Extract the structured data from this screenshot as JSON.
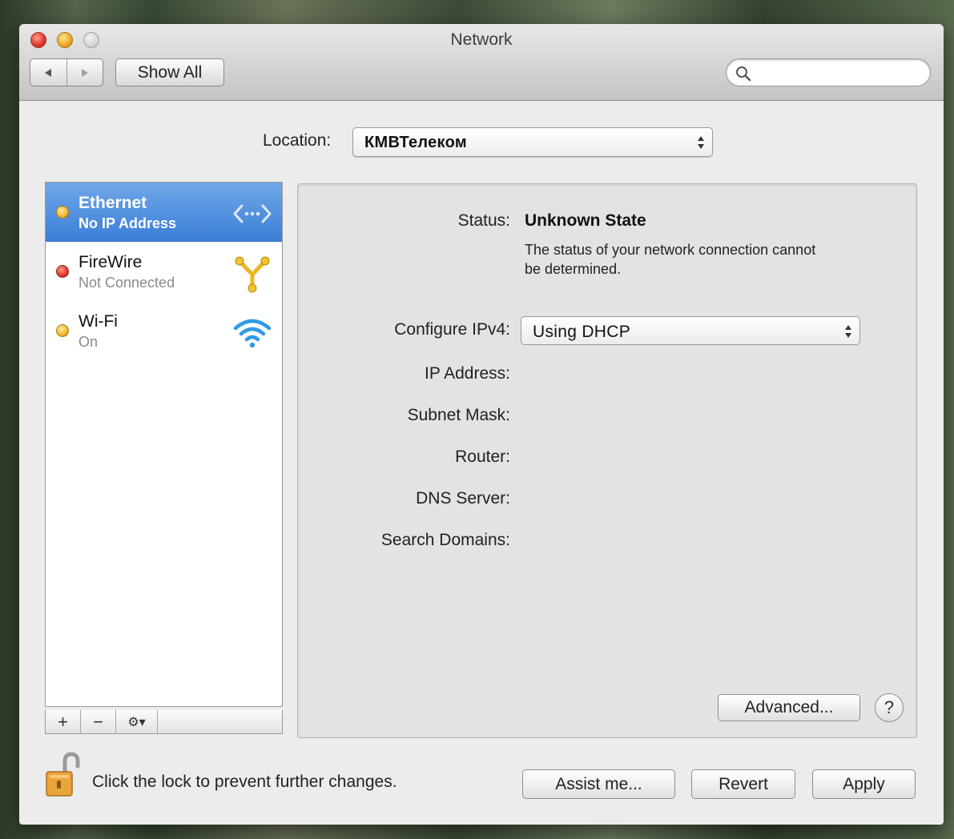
{
  "window": {
    "title": "Network"
  },
  "toolbar": {
    "back_icon": "triangle-left",
    "forward_icon": "triangle-right",
    "show_all_label": "Show All",
    "search": {
      "value": "",
      "placeholder": ""
    }
  },
  "location": {
    "label": "Location:",
    "value": "КМВТелеком"
  },
  "interfaces": [
    {
      "name": "Ethernet",
      "status": "No IP Address",
      "dot": "yellow",
      "icon": "ethernet-arrows-icon",
      "selected": true
    },
    {
      "name": "FireWire",
      "status": "Not Connected",
      "dot": "red",
      "icon": "firewire-icon",
      "selected": false
    },
    {
      "name": "Wi-Fi",
      "status": "On",
      "dot": "yellow",
      "icon": "wifi-icon",
      "selected": false
    }
  ],
  "list_controls": {
    "add": "+",
    "remove": "−",
    "gear": "⚙▾"
  },
  "detail": {
    "status_label": "Status:",
    "status_value": "Unknown State",
    "status_desc": "The status of your network connection cannot be determined.",
    "configure_label": "Configure IPv4:",
    "configure_value": "Using DHCP",
    "ip_label": "IP Address:",
    "subnet_label": "Subnet Mask:",
    "router_label": "Router:",
    "dns_label": "DNS Server:",
    "search_domains_label": "Search Domains:",
    "advanced_label": "Advanced...",
    "help_label": "?"
  },
  "footer": {
    "lock_text": "Click the lock to prevent further changes.",
    "assist_label": "Assist me...",
    "revert_label": "Revert",
    "apply_label": "Apply"
  },
  "colors": {
    "selection": "#3b7fd7",
    "status_yellow": "#f2b526",
    "status_red": "#e0332a"
  }
}
